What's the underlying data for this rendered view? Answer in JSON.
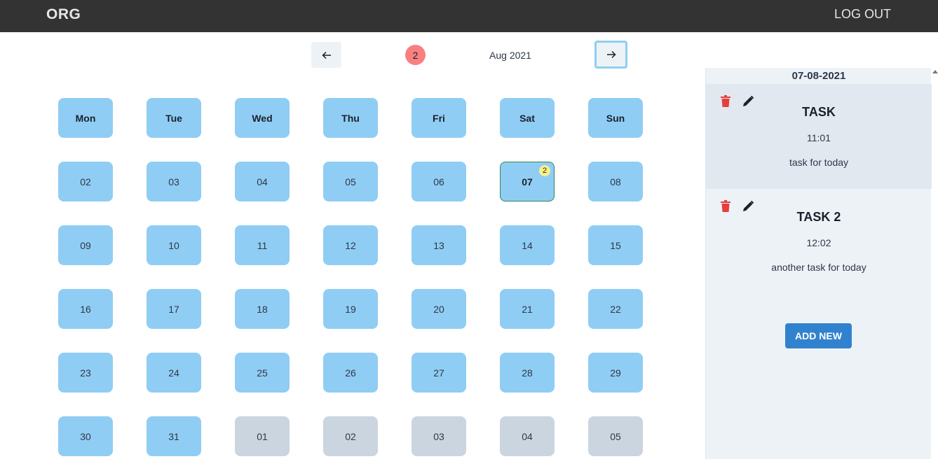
{
  "header": {
    "brand": "ORG",
    "logout": "LOG OUT"
  },
  "calendar_nav": {
    "prev_icon": "arrow-left-icon",
    "next_icon": "arrow-right-icon",
    "task_count": "2",
    "month": "Aug 2021"
  },
  "weekdays": [
    "Mon",
    "Tue",
    "Wed",
    "Thu",
    "Fri",
    "Sat",
    "Sun"
  ],
  "weeks": [
    [
      {
        "d": "02"
      },
      {
        "d": "03"
      },
      {
        "d": "04"
      },
      {
        "d": "05"
      },
      {
        "d": "06"
      },
      {
        "d": "07",
        "selected": true,
        "badge": "2"
      },
      {
        "d": "08"
      }
    ],
    [
      {
        "d": "09"
      },
      {
        "d": "10"
      },
      {
        "d": "11"
      },
      {
        "d": "12"
      },
      {
        "d": "13"
      },
      {
        "d": "14"
      },
      {
        "d": "15"
      }
    ],
    [
      {
        "d": "16"
      },
      {
        "d": "17"
      },
      {
        "d": "18"
      },
      {
        "d": "19"
      },
      {
        "d": "20"
      },
      {
        "d": "21"
      },
      {
        "d": "22"
      }
    ],
    [
      {
        "d": "23"
      },
      {
        "d": "24"
      },
      {
        "d": "25"
      },
      {
        "d": "26"
      },
      {
        "d": "27"
      },
      {
        "d": "28"
      },
      {
        "d": "29"
      }
    ],
    [
      {
        "d": "30"
      },
      {
        "d": "31"
      },
      {
        "d": "01",
        "other": true
      },
      {
        "d": "02",
        "other": true
      },
      {
        "d": "03",
        "other": true
      },
      {
        "d": "04",
        "other": true
      },
      {
        "d": "05",
        "other": true
      }
    ]
  ],
  "panel": {
    "date": "07-08-2021",
    "tasks": [
      {
        "title": "TASK",
        "time": "11:01",
        "description": "task for today"
      },
      {
        "title": "TASK 2",
        "time": "12:02",
        "description": "another task for today"
      }
    ],
    "add_label": "ADD NEW"
  },
  "colors": {
    "day": "#90cdf4",
    "other_day": "#cbd5e0",
    "badge": "#f98080",
    "mini_badge": "#faf089",
    "accent": "#3182ce",
    "trash": "#e53e3e"
  }
}
